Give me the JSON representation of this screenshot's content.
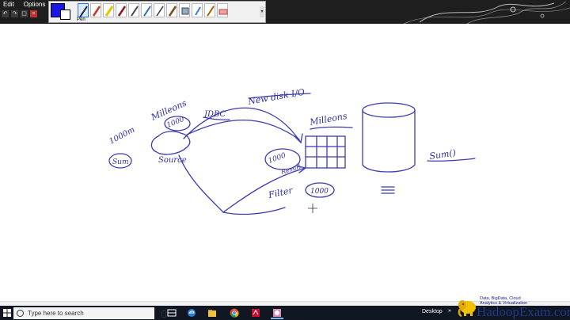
{
  "menu": {
    "edit": "Edit",
    "options": "Options"
  },
  "toolbox": {
    "active_tool_label": "Pen",
    "pen_color": "#1a17e6"
  },
  "drawing": {
    "annotations": [
      {
        "id": "a-1000m",
        "text": "1000m"
      },
      {
        "id": "a-milleons-1",
        "text": "Milleons"
      },
      {
        "id": "a-1000-top",
        "text": "1000"
      },
      {
        "id": "a-new-disk",
        "text": "New disk I/O"
      },
      {
        "id": "a-jdbc",
        "text": "JDBC"
      },
      {
        "id": "a-milleons-2",
        "text": "Milleons"
      },
      {
        "id": "a-sum-left",
        "text": "Sum"
      },
      {
        "id": "a-source",
        "text": "Source"
      },
      {
        "id": "a-1000-mid",
        "text": "1000"
      },
      {
        "id": "a-result",
        "text": "Result"
      },
      {
        "id": "a-filter",
        "text": "Filter"
      },
      {
        "id": "a-1000-low",
        "text": "1000"
      },
      {
        "id": "a-sum-right",
        "text": "Sum()"
      }
    ]
  },
  "taskbar": {
    "search_placeholder": "Type here to search",
    "desktop_label": "Desktop",
    "icons": [
      "task-view-icon",
      "edge-icon",
      "chrome-icon",
      "pdf-icon",
      "app-icon"
    ]
  },
  "branding": {
    "tagline_line1": "Data, BigData, Cloud",
    "tagline_line2": "Analytics & Virtualization",
    "name": "HadoopExam.com"
  }
}
